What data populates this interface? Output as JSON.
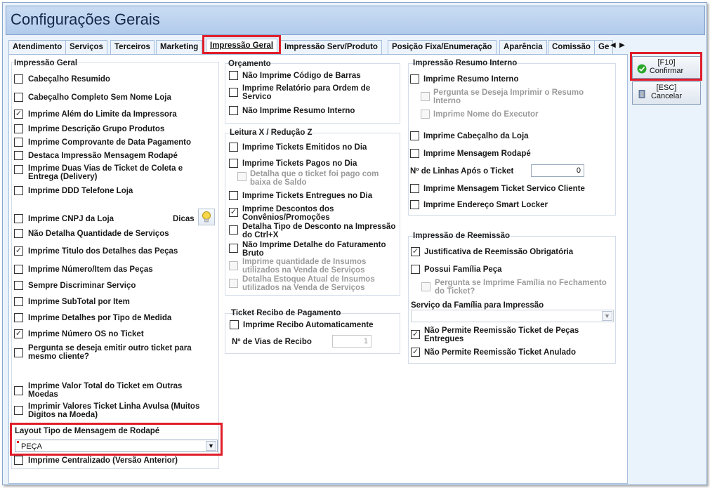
{
  "window": {
    "title": "Configurações Gerais"
  },
  "tabs": [
    "Atendimento",
    "Serviços",
    "Terceiros",
    "Marketing",
    "Impressão Geral",
    "Impressão Serv/Produto",
    "Posição Fixa/Enumeração",
    "Aparência",
    "Comissão",
    "Ge"
  ],
  "active_tab": "Impressão Geral",
  "colors": {
    "highlight": "#e01e2a",
    "confirm_icon": "#2aa82a"
  },
  "buttons": {
    "confirm": {
      "key": "[F10]",
      "label": "Confirmar"
    },
    "cancel": {
      "key": "[ESC]",
      "label": "Cancelar"
    }
  },
  "impressao_geral": {
    "title": "Impressão Geral",
    "items": [
      {
        "label": "Cabeçalho Resumido",
        "checked": false
      },
      {
        "label": "Cabeçalho Completo Sem Nome Loja",
        "checked": false
      },
      {
        "label": "Imprime Além do Limite da Impressora",
        "checked": true
      },
      {
        "label": "Imprime Descrição Grupo Produtos",
        "checked": false
      },
      {
        "label": "Imprime Comprovante de Data Pagamento",
        "checked": false
      },
      {
        "label": "Destaca Impressão Mensagem Rodapé",
        "checked": false
      },
      {
        "label": "Imprime Duas Vias de Ticket de Coleta e Entrega (Delivery)",
        "checked": false
      },
      {
        "label": "Imprime DDD Telefone Loja",
        "checked": false
      },
      {
        "label": "Imprime CNPJ da Loja",
        "checked": false
      },
      {
        "label": "Não Detalha Quantidade de Serviços",
        "checked": false
      },
      {
        "label": "Imprime Titulo dos Detalhes das Peças",
        "checked": true
      },
      {
        "label": "Imprime Número/Item das Peças",
        "checked": false
      },
      {
        "label": "Sempre Discriminar Serviço",
        "checked": false
      },
      {
        "label": "Imprime SubTotal por Item",
        "checked": false
      },
      {
        "label": "Imprime Detalhes por Tipo de Medida",
        "checked": false
      },
      {
        "label": "Imprime Número OS no Ticket",
        "checked": true
      },
      {
        "label": "Pergunta se deseja emitir outro ticket para mesmo cliente?",
        "checked": false
      },
      {
        "label": "Imprime Valor Total do Ticket em Outras Moedas",
        "checked": false
      },
      {
        "label": "Imprimir Valores Ticket Linha Avulsa (Muitos Digitos na Moeda)",
        "checked": false
      },
      {
        "label": "Imprime Centralizado (Versão Anterior)",
        "checked": false
      }
    ],
    "dicas_label": "Dicas",
    "layout_label": "Layout Tipo de Mensagem de Rodapé",
    "layout_value": "PEÇA"
  },
  "orcamento": {
    "title": "Orçamento",
    "items": [
      {
        "label": "Não Imprime Código de Barras",
        "checked": false
      },
      {
        "label": "Imprime Relatório para Ordem de Servico",
        "checked": false
      },
      {
        "label": "Não Imprime Resumo Interno",
        "checked": false
      }
    ]
  },
  "leitura": {
    "title": "Leitura X / Redução Z",
    "items": [
      {
        "label": "Imprime Tickets Emitidos no Dia",
        "checked": false,
        "disabled": false
      },
      {
        "label": "Imprime Tickets Pagos no Dia",
        "checked": false,
        "disabled": false
      },
      {
        "label": "Detalha que o ticket foi pago com baixa de Saldo",
        "checked": false,
        "disabled": true
      },
      {
        "label": "Imprime Tickets Entregues no Dia",
        "checked": false,
        "disabled": false
      },
      {
        "label": "Imprime Descontos dos Convênios/Promoções",
        "checked": true,
        "disabled": false
      },
      {
        "label": "Detalha Tipo de Desconto na Impressão do Ctrl+X",
        "checked": false,
        "disabled": false
      },
      {
        "label": "Não Imprime Detalhe do Faturamento Bruto",
        "checked": false,
        "disabled": false
      },
      {
        "label": "Imprime quantidade de Insumos utilizados na Venda de Serviços",
        "checked": false,
        "disabled": true
      },
      {
        "label": "Detalha Estoque Atual de Insumos utilizados na Venda de Serviços",
        "checked": false,
        "disabled": true
      }
    ]
  },
  "ticket_recibo": {
    "title": "Ticket Recibo de Pagamento",
    "auto_label": "Imprime Recibo Automaticamente",
    "auto_checked": false,
    "vias_label": "Nº de Vias  de Recibo",
    "vias_value": "1"
  },
  "resumo_interno": {
    "title": "Impressão Resumo Interno",
    "items": [
      {
        "label": "Imprime Resumo Interno",
        "checked": false,
        "disabled": false
      },
      {
        "label": "Pergunta se Deseja Imprimir o Resumo Interno",
        "checked": false,
        "disabled": true
      },
      {
        "label": "Imprime Nome do Executor",
        "checked": false,
        "disabled": true
      },
      {
        "label": "Imprime Cabeçalho da Loja",
        "checked": false,
        "disabled": false
      },
      {
        "label": "Imprime Mensagem Rodapé",
        "checked": false,
        "disabled": false
      },
      {
        "label": "Imprime Mensagem Ticket Servico Cliente",
        "checked": false,
        "disabled": false
      },
      {
        "label": "Imprime Endereço Smart Locker",
        "checked": false,
        "disabled": false
      }
    ],
    "linhas_label": "Nº de Linhas Após o Ticket",
    "linhas_value": "0"
  },
  "reemissao": {
    "title": "Impressão de Reemissão",
    "items": [
      {
        "label": "Justificativa de Reemissão Obrigatória",
        "checked": true,
        "disabled": false
      },
      {
        "label": "Possui Família Peça",
        "checked": false,
        "disabled": false
      },
      {
        "label": "Pergunta se Imprime Família no Fechamento do Ticket?",
        "checked": false,
        "disabled": true
      },
      {
        "label": "Não Permite Reemissão Ticket de Peças Entregues",
        "checked": true,
        "disabled": false
      },
      {
        "label": "Não Permite Reemissão Ticket Anulado",
        "checked": true,
        "disabled": false
      }
    ],
    "familia_label": "Serviço da Família para Impressão",
    "familia_value": ""
  }
}
